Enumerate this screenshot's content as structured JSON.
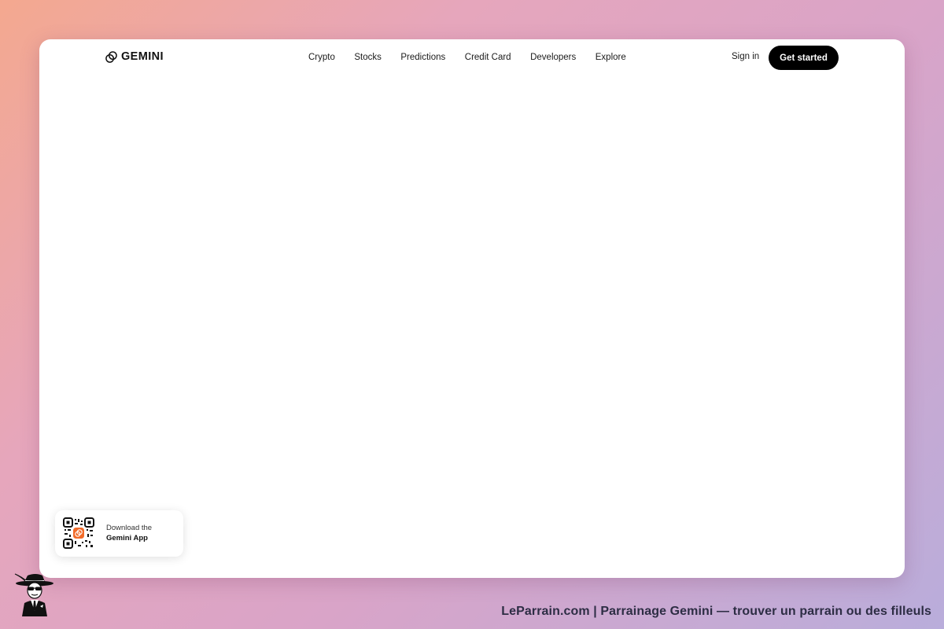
{
  "header": {
    "brand": "GEMINI",
    "nav": [
      {
        "label": "Crypto"
      },
      {
        "label": "Stocks"
      },
      {
        "label": "Predictions"
      },
      {
        "label": "Credit Card"
      },
      {
        "label": "Developers"
      },
      {
        "label": "Explore"
      }
    ],
    "sign_in_label": "Sign in",
    "get_started_label": "Get started"
  },
  "app_card": {
    "line1": "Download the",
    "line2": "Gemini App",
    "qr_accent_color": "#f26b2a"
  },
  "footer": {
    "caption": "LeParrain.com | Parrainage Gemini — trouver un parrain ou des filleuls"
  },
  "icons": {
    "logo": "gemini-logo-icon",
    "qr": "qr-code-icon",
    "mascot": "parrain-mascot-icon"
  },
  "colors": {
    "cta_background": "#000000",
    "cta_text": "#ffffff",
    "page_gradient_start": "#f4a88f",
    "page_gradient_end": "#b9addb"
  }
}
